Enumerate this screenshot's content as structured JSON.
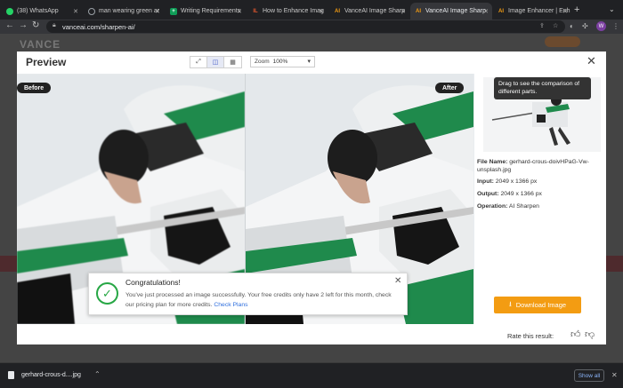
{
  "browser": {
    "tabs": [
      {
        "title": "(38) WhatsApp",
        "icon": "whatsapp-icon",
        "color": "#25d366"
      },
      {
        "title": "man wearing green ar",
        "icon": "globe-icon",
        "color": "#9aa0a6"
      },
      {
        "title": "Writing Requirements",
        "icon": "sheets-plus-icon",
        "color": "#0f9d58"
      },
      {
        "title": "How to Enhance Imag",
        "icon": "il-icon",
        "color": "#e4572e"
      },
      {
        "title": "VanceAI Image Sharp",
        "icon": "vanceai-icon",
        "color": "#f39c12"
      },
      {
        "title": "VanceAI Image Sharp",
        "icon": "vanceai-icon",
        "color": "#f39c12"
      },
      {
        "title": "Image Enhancer | Enh",
        "icon": "vanceai-icon",
        "color": "#f39c12"
      }
    ],
    "active_tab": 5,
    "url": "vanceai.com/sharpen-ai/",
    "profile_initial": "W"
  },
  "page": {
    "logo": "VANCE"
  },
  "modal": {
    "title": "Preview",
    "zoom_label": "Zoom",
    "zoom_value": "100%",
    "before_label": "Before",
    "after_label": "After",
    "tooltip": "Drag to see the comparison of different parts.",
    "file_name_label": "File Name:",
    "file_name": "gerhard-crous-doivHPaG-Vw-unsplash.jpg",
    "input_label": "Input:",
    "input_value": "2049 x 1366 px",
    "output_label": "Output:",
    "output_value": "2049 x 1366 px",
    "operation_label": "Operation:",
    "operation_value": "AI Sharpen",
    "download_label": "Download Image",
    "rate_label": "Rate this result:",
    "accent_color": "#f39c12"
  },
  "toast": {
    "title": "Congratulations!",
    "message": "You've just processed an image successfully. Your free credits only have 2 left for this month, check our pricing plan for more credits.",
    "link": "Check Plans"
  },
  "downloads": {
    "file": "gerhard-crous-d....jpg",
    "show_all": "Show all"
  }
}
